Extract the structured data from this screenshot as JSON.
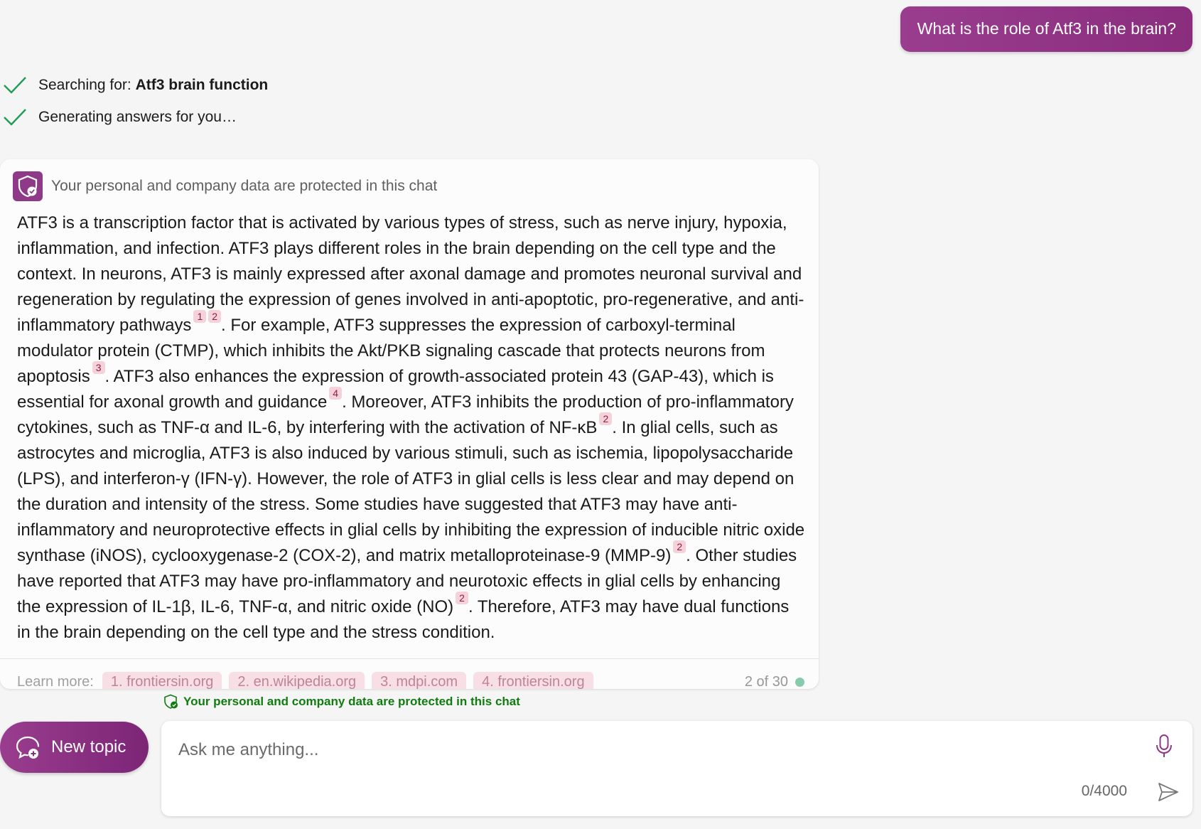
{
  "user_message": "What is the role of Atf3 in the brain?",
  "status": {
    "search_prefix": "Searching for: ",
    "search_query": "Atf3 brain function",
    "generating": "Generating answers for you…"
  },
  "answer": {
    "header": "Your personal and company data are protected in this chat",
    "paragraph": [
      {
        "t": "ATF3 is a transcription factor that is activated by various types of stress, such as nerve injury, hypoxia, inflammation, and infection. ATF3 plays different roles in the brain depending on the cell type and the context. In neurons, ATF3 is mainly expressed after axonal damage and promotes neuronal survival and regeneration by regulating the expression of genes involved in anti-apoptotic, pro-regenerative, and anti-inflammatory pathways"
      },
      {
        "c": "1"
      },
      {
        "c": "2"
      },
      {
        "t": ". For example, ATF3 suppresses the expression of carboxyl-terminal modulator protein (CTMP), which inhibits the Akt/PKB signaling cascade that protects neurons from apoptosis"
      },
      {
        "c": "3"
      },
      {
        "t": ". ATF3 also enhances the expression of growth-associated protein 43 (GAP-43), which is essential for axonal growth and guidance"
      },
      {
        "c": "4"
      },
      {
        "t": ". Moreover, ATF3 inhibits the production of pro-inflammatory cytokines, such as TNF-α and IL-6, by interfering with the activation of NF-κB"
      },
      {
        "c": "2"
      },
      {
        "t": ". In glial cells, such as astrocytes and microglia, ATF3 is also induced by various stimuli, such as ischemia, lipopolysaccharide (LPS), and interferon-γ (IFN-γ). However, the role of ATF3 in glial cells is less clear and may depend on the duration and intensity of the stress. Some studies have suggested that ATF3 may have anti-inflammatory and neuroprotective effects in glial cells by inhibiting the expression of inducible nitric oxide synthase (iNOS), cyclooxygenase-2 (COX-2), and matrix metalloproteinase-9 (MMP-9)"
      },
      {
        "c": "2"
      },
      {
        "t": ". Other studies have reported that ATF3 may have pro-inflammatory and neurotoxic effects in glial cells by enhancing the expression of IL-1β, IL-6, TNF-α, and nitric oxide (NO)"
      },
      {
        "c": "2"
      },
      {
        "t": ". Therefore, ATF3 may have dual functions in the brain depending on the cell type and the stress condition."
      }
    ],
    "learn_more_label": "Learn more:",
    "learn_more_links": [
      "1. frontiersin.org",
      "2. en.wikipedia.org",
      "3. mdpi.com",
      "4. frontiersin.org"
    ],
    "response_count": "2 of 30"
  },
  "privacy_note": "Your personal and company data are protected in this chat",
  "new_topic_label": "New topic",
  "input": {
    "placeholder": "Ask me anything...",
    "value": "",
    "char_count": "0/4000"
  },
  "colors": {
    "accent": "#8e3a88",
    "check_green": "#1f9d55",
    "privacy_green": "#107c10",
    "citation_bg": "#f5d2da"
  },
  "icons": [
    "check-icon",
    "shield-check-icon",
    "new-chat-icon",
    "microphone-icon",
    "send-icon"
  ]
}
